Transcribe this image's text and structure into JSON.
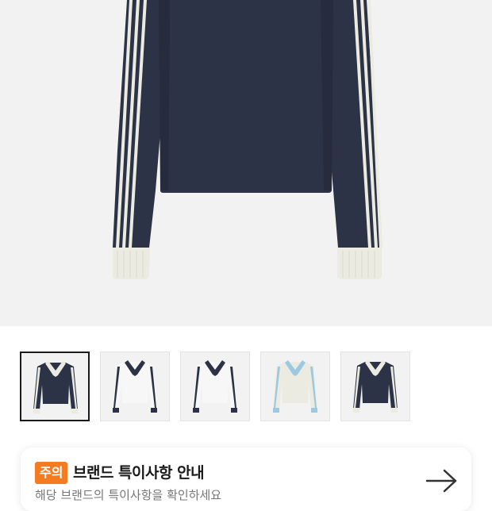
{
  "colors": {
    "navy": "#2c3346",
    "cream": "#ecebe2",
    "white": "#f7f7f7",
    "sky": "#9cc9e2",
    "accent_orange": "#f47b1f"
  },
  "hero": {
    "image": "navy long-sleeve polo with three cream sleeve stripes"
  },
  "thumbnails": [
    {
      "alt": "navy-white-collar-top",
      "selected": true
    },
    {
      "alt": "white-navy-collar-top",
      "selected": false
    },
    {
      "alt": "white-navy-collar-top-alt",
      "selected": false
    },
    {
      "alt": "cream-sky-blue-top",
      "selected": false
    },
    {
      "alt": "navy-white-collar-top-alt",
      "selected": false
    }
  ],
  "notice": {
    "badge": "주의",
    "title": "브랜드 특이사항 안내",
    "subtitle": "해당 브랜드의 특이사항을 확인하세요",
    "arrow_icon": "arrow-right-icon"
  }
}
